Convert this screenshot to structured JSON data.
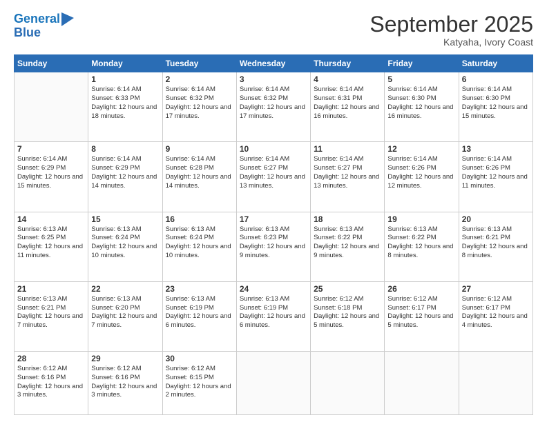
{
  "header": {
    "logo_line1": "General",
    "logo_line2": "Blue",
    "month": "September 2025",
    "location": "Katyaha, Ivory Coast"
  },
  "weekdays": [
    "Sunday",
    "Monday",
    "Tuesday",
    "Wednesday",
    "Thursday",
    "Friday",
    "Saturday"
  ],
  "rows": [
    [
      {
        "day": "",
        "sunrise": "",
        "sunset": "",
        "daylight": ""
      },
      {
        "day": "1",
        "sunrise": "Sunrise: 6:14 AM",
        "sunset": "Sunset: 6:33 PM",
        "daylight": "Daylight: 12 hours and 18 minutes."
      },
      {
        "day": "2",
        "sunrise": "Sunrise: 6:14 AM",
        "sunset": "Sunset: 6:32 PM",
        "daylight": "Daylight: 12 hours and 17 minutes."
      },
      {
        "day": "3",
        "sunrise": "Sunrise: 6:14 AM",
        "sunset": "Sunset: 6:32 PM",
        "daylight": "Daylight: 12 hours and 17 minutes."
      },
      {
        "day": "4",
        "sunrise": "Sunrise: 6:14 AM",
        "sunset": "Sunset: 6:31 PM",
        "daylight": "Daylight: 12 hours and 16 minutes."
      },
      {
        "day": "5",
        "sunrise": "Sunrise: 6:14 AM",
        "sunset": "Sunset: 6:30 PM",
        "daylight": "Daylight: 12 hours and 16 minutes."
      },
      {
        "day": "6",
        "sunrise": "Sunrise: 6:14 AM",
        "sunset": "Sunset: 6:30 PM",
        "daylight": "Daylight: 12 hours and 15 minutes."
      }
    ],
    [
      {
        "day": "7",
        "sunrise": "Sunrise: 6:14 AM",
        "sunset": "Sunset: 6:29 PM",
        "daylight": "Daylight: 12 hours and 15 minutes."
      },
      {
        "day": "8",
        "sunrise": "Sunrise: 6:14 AM",
        "sunset": "Sunset: 6:29 PM",
        "daylight": "Daylight: 12 hours and 14 minutes."
      },
      {
        "day": "9",
        "sunrise": "Sunrise: 6:14 AM",
        "sunset": "Sunset: 6:28 PM",
        "daylight": "Daylight: 12 hours and 14 minutes."
      },
      {
        "day": "10",
        "sunrise": "Sunrise: 6:14 AM",
        "sunset": "Sunset: 6:27 PM",
        "daylight": "Daylight: 12 hours and 13 minutes."
      },
      {
        "day": "11",
        "sunrise": "Sunrise: 6:14 AM",
        "sunset": "Sunset: 6:27 PM",
        "daylight": "Daylight: 12 hours and 13 minutes."
      },
      {
        "day": "12",
        "sunrise": "Sunrise: 6:14 AM",
        "sunset": "Sunset: 6:26 PM",
        "daylight": "Daylight: 12 hours and 12 minutes."
      },
      {
        "day": "13",
        "sunrise": "Sunrise: 6:14 AM",
        "sunset": "Sunset: 6:26 PM",
        "daylight": "Daylight: 12 hours and 11 minutes."
      }
    ],
    [
      {
        "day": "14",
        "sunrise": "Sunrise: 6:13 AM",
        "sunset": "Sunset: 6:25 PM",
        "daylight": "Daylight: 12 hours and 11 minutes."
      },
      {
        "day": "15",
        "sunrise": "Sunrise: 6:13 AM",
        "sunset": "Sunset: 6:24 PM",
        "daylight": "Daylight: 12 hours and 10 minutes."
      },
      {
        "day": "16",
        "sunrise": "Sunrise: 6:13 AM",
        "sunset": "Sunset: 6:24 PM",
        "daylight": "Daylight: 12 hours and 10 minutes."
      },
      {
        "day": "17",
        "sunrise": "Sunrise: 6:13 AM",
        "sunset": "Sunset: 6:23 PM",
        "daylight": "Daylight: 12 hours and 9 minutes."
      },
      {
        "day": "18",
        "sunrise": "Sunrise: 6:13 AM",
        "sunset": "Sunset: 6:22 PM",
        "daylight": "Daylight: 12 hours and 9 minutes."
      },
      {
        "day": "19",
        "sunrise": "Sunrise: 6:13 AM",
        "sunset": "Sunset: 6:22 PM",
        "daylight": "Daylight: 12 hours and 8 minutes."
      },
      {
        "day": "20",
        "sunrise": "Sunrise: 6:13 AM",
        "sunset": "Sunset: 6:21 PM",
        "daylight": "Daylight: 12 hours and 8 minutes."
      }
    ],
    [
      {
        "day": "21",
        "sunrise": "Sunrise: 6:13 AM",
        "sunset": "Sunset: 6:21 PM",
        "daylight": "Daylight: 12 hours and 7 minutes."
      },
      {
        "day": "22",
        "sunrise": "Sunrise: 6:13 AM",
        "sunset": "Sunset: 6:20 PM",
        "daylight": "Daylight: 12 hours and 7 minutes."
      },
      {
        "day": "23",
        "sunrise": "Sunrise: 6:13 AM",
        "sunset": "Sunset: 6:19 PM",
        "daylight": "Daylight: 12 hours and 6 minutes."
      },
      {
        "day": "24",
        "sunrise": "Sunrise: 6:13 AM",
        "sunset": "Sunset: 6:19 PM",
        "daylight": "Daylight: 12 hours and 6 minutes."
      },
      {
        "day": "25",
        "sunrise": "Sunrise: 6:12 AM",
        "sunset": "Sunset: 6:18 PM",
        "daylight": "Daylight: 12 hours and 5 minutes."
      },
      {
        "day": "26",
        "sunrise": "Sunrise: 6:12 AM",
        "sunset": "Sunset: 6:17 PM",
        "daylight": "Daylight: 12 hours and 5 minutes."
      },
      {
        "day": "27",
        "sunrise": "Sunrise: 6:12 AM",
        "sunset": "Sunset: 6:17 PM",
        "daylight": "Daylight: 12 hours and 4 minutes."
      }
    ],
    [
      {
        "day": "28",
        "sunrise": "Sunrise: 6:12 AM",
        "sunset": "Sunset: 6:16 PM",
        "daylight": "Daylight: 12 hours and 3 minutes."
      },
      {
        "day": "29",
        "sunrise": "Sunrise: 6:12 AM",
        "sunset": "Sunset: 6:16 PM",
        "daylight": "Daylight: 12 hours and 3 minutes."
      },
      {
        "day": "30",
        "sunrise": "Sunrise: 6:12 AM",
        "sunset": "Sunset: 6:15 PM",
        "daylight": "Daylight: 12 hours and 2 minutes."
      },
      {
        "day": "",
        "sunrise": "",
        "sunset": "",
        "daylight": ""
      },
      {
        "day": "",
        "sunrise": "",
        "sunset": "",
        "daylight": ""
      },
      {
        "day": "",
        "sunrise": "",
        "sunset": "",
        "daylight": ""
      },
      {
        "day": "",
        "sunrise": "",
        "sunset": "",
        "daylight": ""
      }
    ]
  ]
}
